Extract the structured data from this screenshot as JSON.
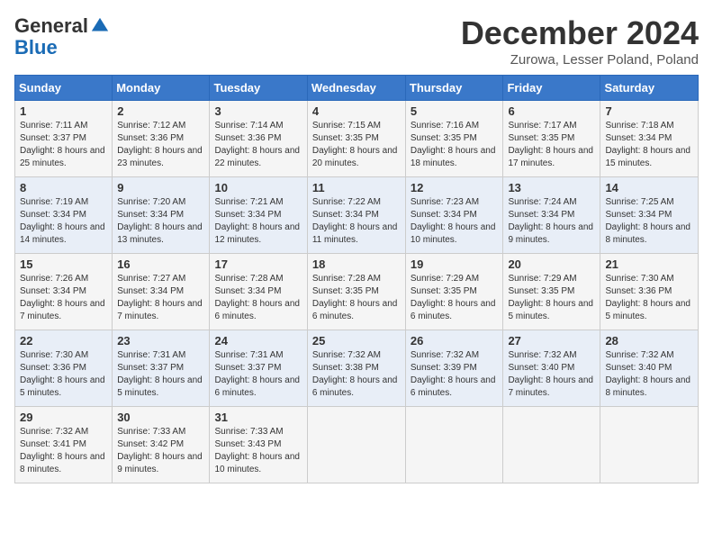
{
  "header": {
    "logo_general": "General",
    "logo_blue": "Blue",
    "month_title": "December 2024",
    "location": "Zurowa, Lesser Poland, Poland"
  },
  "weekdays": [
    "Sunday",
    "Monday",
    "Tuesday",
    "Wednesday",
    "Thursday",
    "Friday",
    "Saturday"
  ],
  "weeks": [
    [
      {
        "day": "1",
        "sunrise": "7:11 AM",
        "sunset": "3:37 PM",
        "daylight": "8 hours and 25 minutes."
      },
      {
        "day": "2",
        "sunrise": "7:12 AM",
        "sunset": "3:36 PM",
        "daylight": "8 hours and 23 minutes."
      },
      {
        "day": "3",
        "sunrise": "7:14 AM",
        "sunset": "3:36 PM",
        "daylight": "8 hours and 22 minutes."
      },
      {
        "day": "4",
        "sunrise": "7:15 AM",
        "sunset": "3:35 PM",
        "daylight": "8 hours and 20 minutes."
      },
      {
        "day": "5",
        "sunrise": "7:16 AM",
        "sunset": "3:35 PM",
        "daylight": "8 hours and 18 minutes."
      },
      {
        "day": "6",
        "sunrise": "7:17 AM",
        "sunset": "3:35 PM",
        "daylight": "8 hours and 17 minutes."
      },
      {
        "day": "7",
        "sunrise": "7:18 AM",
        "sunset": "3:34 PM",
        "daylight": "8 hours and 15 minutes."
      }
    ],
    [
      {
        "day": "8",
        "sunrise": "7:19 AM",
        "sunset": "3:34 PM",
        "daylight": "8 hours and 14 minutes."
      },
      {
        "day": "9",
        "sunrise": "7:20 AM",
        "sunset": "3:34 PM",
        "daylight": "8 hours and 13 minutes."
      },
      {
        "day": "10",
        "sunrise": "7:21 AM",
        "sunset": "3:34 PM",
        "daylight": "8 hours and 12 minutes."
      },
      {
        "day": "11",
        "sunrise": "7:22 AM",
        "sunset": "3:34 PM",
        "daylight": "8 hours and 11 minutes."
      },
      {
        "day": "12",
        "sunrise": "7:23 AM",
        "sunset": "3:34 PM",
        "daylight": "8 hours and 10 minutes."
      },
      {
        "day": "13",
        "sunrise": "7:24 AM",
        "sunset": "3:34 PM",
        "daylight": "8 hours and 9 minutes."
      },
      {
        "day": "14",
        "sunrise": "7:25 AM",
        "sunset": "3:34 PM",
        "daylight": "8 hours and 8 minutes."
      }
    ],
    [
      {
        "day": "15",
        "sunrise": "7:26 AM",
        "sunset": "3:34 PM",
        "daylight": "8 hours and 7 minutes."
      },
      {
        "day": "16",
        "sunrise": "7:27 AM",
        "sunset": "3:34 PM",
        "daylight": "8 hours and 7 minutes."
      },
      {
        "day": "17",
        "sunrise": "7:28 AM",
        "sunset": "3:34 PM",
        "daylight": "8 hours and 6 minutes."
      },
      {
        "day": "18",
        "sunrise": "7:28 AM",
        "sunset": "3:35 PM",
        "daylight": "8 hours and 6 minutes."
      },
      {
        "day": "19",
        "sunrise": "7:29 AM",
        "sunset": "3:35 PM",
        "daylight": "8 hours and 6 minutes."
      },
      {
        "day": "20",
        "sunrise": "7:29 AM",
        "sunset": "3:35 PM",
        "daylight": "8 hours and 5 minutes."
      },
      {
        "day": "21",
        "sunrise": "7:30 AM",
        "sunset": "3:36 PM",
        "daylight": "8 hours and 5 minutes."
      }
    ],
    [
      {
        "day": "22",
        "sunrise": "7:30 AM",
        "sunset": "3:36 PM",
        "daylight": "8 hours and 5 minutes."
      },
      {
        "day": "23",
        "sunrise": "7:31 AM",
        "sunset": "3:37 PM",
        "daylight": "8 hours and 5 minutes."
      },
      {
        "day": "24",
        "sunrise": "7:31 AM",
        "sunset": "3:37 PM",
        "daylight": "8 hours and 6 minutes."
      },
      {
        "day": "25",
        "sunrise": "7:32 AM",
        "sunset": "3:38 PM",
        "daylight": "8 hours and 6 minutes."
      },
      {
        "day": "26",
        "sunrise": "7:32 AM",
        "sunset": "3:39 PM",
        "daylight": "8 hours and 6 minutes."
      },
      {
        "day": "27",
        "sunrise": "7:32 AM",
        "sunset": "3:40 PM",
        "daylight": "8 hours and 7 minutes."
      },
      {
        "day": "28",
        "sunrise": "7:32 AM",
        "sunset": "3:40 PM",
        "daylight": "8 hours and 8 minutes."
      }
    ],
    [
      {
        "day": "29",
        "sunrise": "7:32 AM",
        "sunset": "3:41 PM",
        "daylight": "8 hours and 8 minutes."
      },
      {
        "day": "30",
        "sunrise": "7:33 AM",
        "sunset": "3:42 PM",
        "daylight": "8 hours and 9 minutes."
      },
      {
        "day": "31",
        "sunrise": "7:33 AM",
        "sunset": "3:43 PM",
        "daylight": "8 hours and 10 minutes."
      },
      null,
      null,
      null,
      null
    ]
  ],
  "labels": {
    "sunrise": "Sunrise:",
    "sunset": "Sunset:",
    "daylight": "Daylight:"
  }
}
